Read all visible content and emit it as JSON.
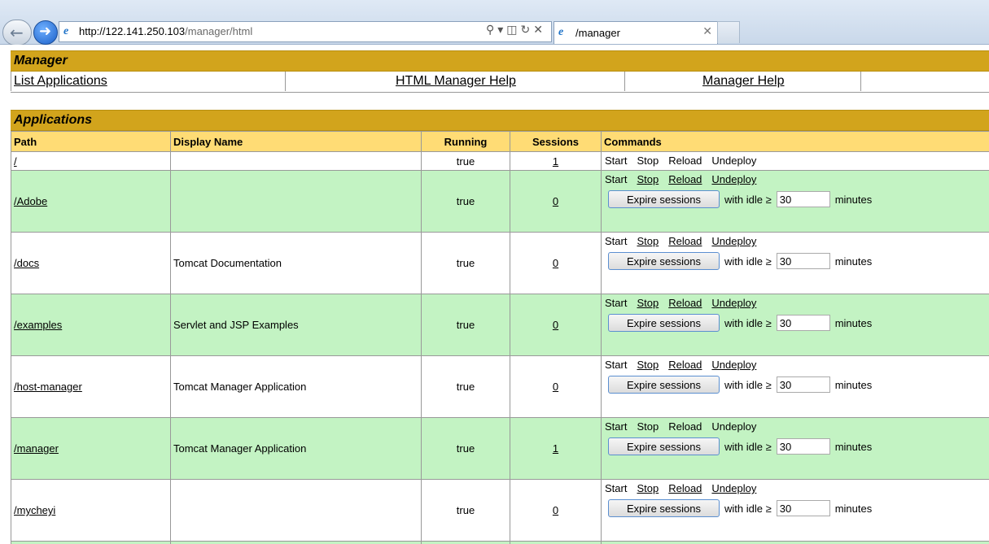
{
  "browser": {
    "url_host": "http://122.141.250.103",
    "url_path": "/manager/html",
    "tab_title": "/manager"
  },
  "manager": {
    "title": "Manager",
    "links": [
      "List Applications",
      "HTML Manager Help",
      "Manager Help"
    ]
  },
  "applications": {
    "title": "Applications",
    "headers": {
      "path": "Path",
      "display_name": "Display Name",
      "running": "Running",
      "sessions": "Sessions",
      "commands": "Commands"
    },
    "rows": [
      {
        "path": "/",
        "display_name": "",
        "running": "true",
        "sessions": "1"
      },
      {
        "path": "/Adobe",
        "display_name": "",
        "running": "true",
        "sessions": "0"
      },
      {
        "path": "/docs",
        "display_name": "Tomcat Documentation",
        "running": "true",
        "sessions": "0"
      },
      {
        "path": "/examples",
        "display_name": "Servlet and JSP Examples",
        "running": "true",
        "sessions": "0"
      },
      {
        "path": "/host-manager",
        "display_name": "Tomcat Manager Application",
        "running": "true",
        "sessions": "0"
      },
      {
        "path": "/manager",
        "display_name": "Tomcat Manager Application",
        "running": "true",
        "sessions": "1"
      },
      {
        "path": "/mycheyi",
        "display_name": "",
        "running": "true",
        "sessions": "0"
      }
    ],
    "commands": {
      "start": "Start",
      "stop": "Stop",
      "reload": "Reload",
      "undeploy": "Undeploy",
      "expire_button": "Expire sessions",
      "with_idle": "with idle ≥",
      "idle_value": "30",
      "minutes": "minutes"
    }
  }
}
